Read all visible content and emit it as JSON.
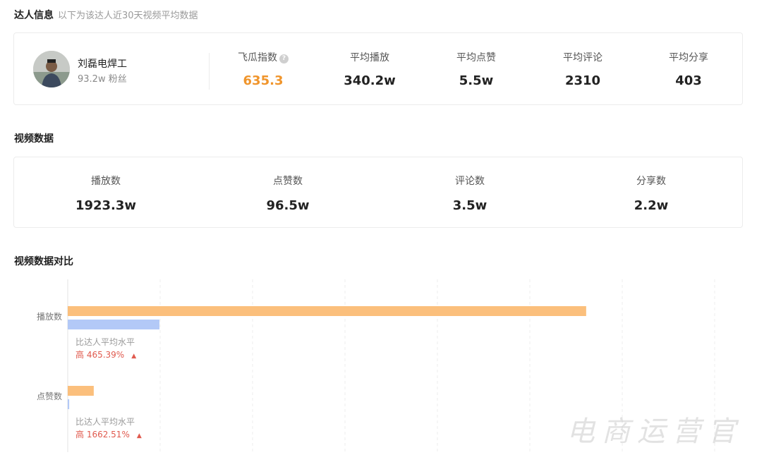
{
  "influencer": {
    "section_title": "达人信息",
    "section_subtitle": "以下为该达人近30天视频平均数据",
    "name": "刘磊电焊工",
    "fans": "93.2w 粉丝",
    "metrics": [
      {
        "label": "飞瓜指数",
        "value": "635.3",
        "accent": "#f0952c",
        "help_icon": "question-circle-icon"
      },
      {
        "label": "平均播放",
        "value": "340.2w"
      },
      {
        "label": "平均点赞",
        "value": "5.5w"
      },
      {
        "label": "平均评论",
        "value": "2310"
      },
      {
        "label": "平均分享",
        "value": "403"
      }
    ]
  },
  "video": {
    "section_title": "视频数据",
    "stats": [
      {
        "label": "播放数",
        "value": "1923.3w"
      },
      {
        "label": "点赞数",
        "value": "96.5w"
      },
      {
        "label": "评论数",
        "value": "3.5w"
      },
      {
        "label": "分享数",
        "value": "2.2w"
      }
    ]
  },
  "comparison": {
    "section_title": "视频数据对比",
    "notes": [
      {
        "label": "比达人平均水平",
        "value": "高 465.39%",
        "arrow": "▲"
      },
      {
        "label": "比达人平均水平",
        "value": "高 1662.51%",
        "arrow": "▲"
      }
    ]
  },
  "chart_data": {
    "type": "bar",
    "orientation": "horizontal",
    "categories": [
      "播放数",
      "点赞数"
    ],
    "series": [
      {
        "color": "#fbbf7c",
        "values": [
          1923.3,
          96.5
        ]
      },
      {
        "color": "#b3c9f7",
        "values": [
          340.2,
          5.5
        ]
      }
    ],
    "xlim": [
      0,
      2400
    ],
    "grid": true
  },
  "watermark": "电商运营官",
  "colors": {
    "accent": "#f0952c",
    "increase": "#e05a4e"
  }
}
